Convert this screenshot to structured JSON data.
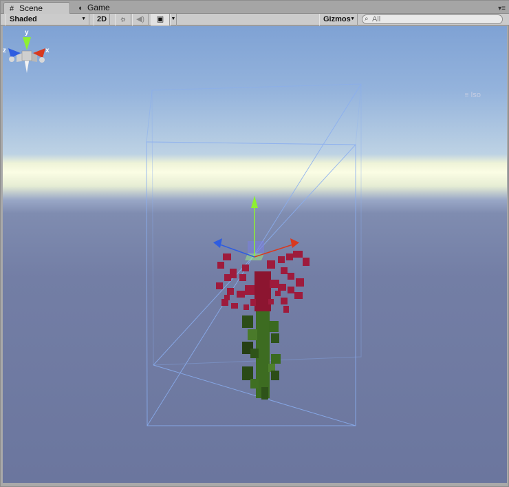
{
  "tabs": {
    "scene_label": "Scene",
    "game_label": "Game"
  },
  "toolbar": {
    "shading_mode": "Shaded",
    "two_d_label": "2D",
    "gizmos_label": "Gizmos",
    "search_placeholder": "All"
  },
  "orientation_gizmo": {
    "axis_y": "y",
    "axis_x": "x",
    "axis_z": "z",
    "projection": "Iso"
  },
  "colors": {
    "sky_top": "#7fa2d4",
    "horizon": "#fbfde4",
    "ground": "#6b769e",
    "bounds_wire": "#8aaef0",
    "flower_petal": "#9e1b3c",
    "flower_stem": "#3a6a1f",
    "axis_x": "#d9391e",
    "axis_y": "#8ef032",
    "axis_z": "#2f5de0"
  },
  "icons": {
    "scene_tab": "hash-grid-icon",
    "game_tab": "pacman-icon",
    "lighting": "sun-icon",
    "audio": "speaker-icon",
    "effects": "image-icon",
    "search": "magnifier-icon",
    "tab_menu": "list-menu-icon"
  }
}
